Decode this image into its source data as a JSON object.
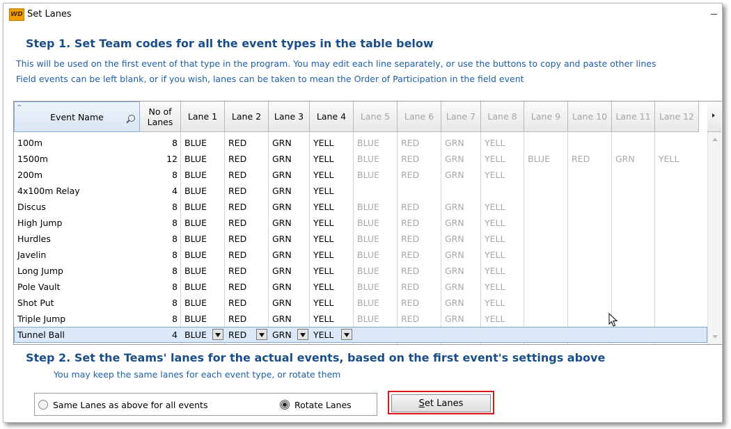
{
  "window": {
    "title": "Set Lanes",
    "app_icon_text": "WD"
  },
  "step1": {
    "title": "Step 1.  Set Team codes for all the event types in the table below",
    "desc1": "This will be used on the first event of that type in the program.  You may edit each line separately, or use the buttons to copy and paste other lines",
    "desc2": "Field events can be left blank, or if you wish, lanes can be taken to mean the Order of Participation in the field event"
  },
  "table": {
    "headers": [
      "Event Name",
      "No of\nLanes",
      "Lane 1",
      "Lane 2",
      "Lane 3",
      "Lane 4",
      "Lane 5",
      "Lane 6",
      "Lane 7",
      "Lane 8",
      "Lane 9",
      "Lane 10",
      "Lane 11",
      "Lane 12"
    ],
    "rows": [
      {
        "name": "100m",
        "lanes": "8",
        "teams": [
          "BLUE",
          "RED",
          "GRN",
          "YELL",
          "BLUE",
          "RED",
          "GRN",
          "YELL",
          "",
          "",
          "",
          ""
        ]
      },
      {
        "name": "1500m",
        "lanes": "12",
        "teams": [
          "BLUE",
          "RED",
          "GRN",
          "YELL",
          "BLUE",
          "RED",
          "GRN",
          "YELL",
          "BLUE",
          "RED",
          "GRN",
          "YELL"
        ]
      },
      {
        "name": "200m",
        "lanes": "8",
        "teams": [
          "BLUE",
          "RED",
          "GRN",
          "YELL",
          "BLUE",
          "RED",
          "GRN",
          "YELL",
          "",
          "",
          "",
          ""
        ]
      },
      {
        "name": "4x100m Relay",
        "lanes": "4",
        "teams": [
          "BLUE",
          "RED",
          "GRN",
          "YELL",
          "",
          "",
          "",
          "",
          "",
          "",
          "",
          ""
        ]
      },
      {
        "name": "Discus",
        "lanes": "8",
        "teams": [
          "BLUE",
          "RED",
          "GRN",
          "YELL",
          "BLUE",
          "RED",
          "GRN",
          "YELL",
          "",
          "",
          "",
          ""
        ]
      },
      {
        "name": "High Jump",
        "lanes": "8",
        "teams": [
          "BLUE",
          "RED",
          "GRN",
          "YELL",
          "BLUE",
          "RED",
          "GRN",
          "YELL",
          "",
          "",
          "",
          ""
        ]
      },
      {
        "name": "Hurdles",
        "lanes": "8",
        "teams": [
          "BLUE",
          "RED",
          "GRN",
          "YELL",
          "BLUE",
          "RED",
          "GRN",
          "YELL",
          "",
          "",
          "",
          ""
        ]
      },
      {
        "name": "Javelin",
        "lanes": "8",
        "teams": [
          "BLUE",
          "RED",
          "GRN",
          "YELL",
          "BLUE",
          "RED",
          "GRN",
          "YELL",
          "",
          "",
          "",
          ""
        ]
      },
      {
        "name": "Long Jump",
        "lanes": "8",
        "teams": [
          "BLUE",
          "RED",
          "GRN",
          "YELL",
          "BLUE",
          "RED",
          "GRN",
          "YELL",
          "",
          "",
          "",
          ""
        ]
      },
      {
        "name": "Pole Vault",
        "lanes": "8",
        "teams": [
          "BLUE",
          "RED",
          "GRN",
          "YELL",
          "BLUE",
          "RED",
          "GRN",
          "YELL",
          "",
          "",
          "",
          ""
        ]
      },
      {
        "name": "Shot Put",
        "lanes": "8",
        "teams": [
          "BLUE",
          "RED",
          "GRN",
          "YELL",
          "BLUE",
          "RED",
          "GRN",
          "YELL",
          "",
          "",
          "",
          ""
        ]
      },
      {
        "name": "Triple Jump",
        "lanes": "8",
        "teams": [
          "BLUE",
          "RED",
          "GRN",
          "YELL",
          "BLUE",
          "RED",
          "GRN",
          "YELL",
          "",
          "",
          "",
          ""
        ]
      },
      {
        "name": "Tunnel Ball",
        "lanes": "4",
        "teams": [
          "BLUE",
          "RED",
          "GRN",
          "YELL",
          "",
          "",
          "",
          "",
          "",
          "",
          "",
          ""
        ],
        "selected": true
      }
    ]
  },
  "step2": {
    "title": "Step 2.  Set the Teams' lanes for the actual events, based on the first event's settings above",
    "desc": "You may keep the same lanes for each event type, or rotate them"
  },
  "options": {
    "same_lanes_label": "Same Lanes as above for all events",
    "rotate_lanes_label": "Rotate Lanes",
    "selected": "rotate"
  },
  "set_lanes_button": {
    "mnemonic": "S",
    "rest": "et Lanes"
  },
  "colors": {
    "heading": "#1a4e8a",
    "desc": "#1f5fa8",
    "highlight": "#e0121b",
    "disabled_text": "#a8a8a8",
    "selected_row": "#dbe8f8"
  }
}
